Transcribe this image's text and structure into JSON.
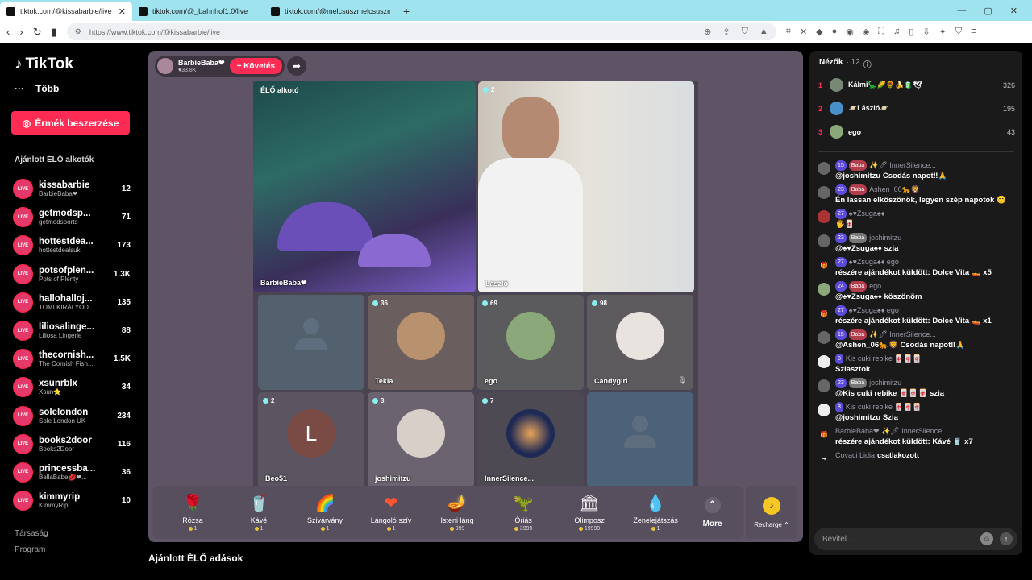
{
  "tabs": [
    {
      "title": "tiktok.com/@kissabarbie/live"
    },
    {
      "title": "tiktok.com/@_bahnhof1.0/live"
    },
    {
      "title": "tiktok.com/@melcsuszmelcsuszmelcs"
    }
  ],
  "address": {
    "url": "https://www.tiktok.com/@kissabarbie/live"
  },
  "sidebar": {
    "logo": "TikTok",
    "more": "Több",
    "coins_button": "Érmék beszerzése",
    "recommended_title": "Ajánlott ÉLŐ alkotók",
    "items": [
      {
        "name": "kissabarbie",
        "sub": "BarbieBaba❤",
        "count": "12"
      },
      {
        "name": "getmodsp...",
        "sub": "getmodsports",
        "count": "71"
      },
      {
        "name": "hottestdea...",
        "sub": "hottestdealsuk",
        "count": "173"
      },
      {
        "name": "potsofplen...",
        "sub": "Pots of Plenty",
        "count": "1.3K"
      },
      {
        "name": "hallohalloj...",
        "sub": "TOMI KIRÁLYOD...",
        "count": "135"
      },
      {
        "name": "liliosalinge...",
        "sub": "Liliosa Lingerie",
        "count": "88"
      },
      {
        "name": "thecornish...",
        "sub": "The Cornish Fish...",
        "count": "1.5K"
      },
      {
        "name": "xsunrblx",
        "sub": "Xsun⭐",
        "count": "34"
      },
      {
        "name": "solelondon",
        "sub": "Sole London UK",
        "count": "234"
      },
      {
        "name": "books2door",
        "sub": "Books2Door",
        "count": "116"
      },
      {
        "name": "princessba...",
        "sub": "BellaBabe💋❤...",
        "count": "36"
      },
      {
        "name": "kimmyrip",
        "sub": "KimmyRip",
        "count": "10"
      }
    ],
    "footer": [
      "Társaság",
      "Program"
    ]
  },
  "stage": {
    "host_name": "BarbieBaba❤",
    "host_likes": "33.8K",
    "follow": "+ Követés",
    "main_tile_top": "ÉLŐ alkotó",
    "main_tile_name": "BarbieBaba❤",
    "guest_count": "2",
    "guest_name": "László",
    "tiles": [
      {
        "name": "",
        "count": ""
      },
      {
        "name": "Tekla",
        "count": "36"
      },
      {
        "name": "ego",
        "count": "69"
      },
      {
        "name": "Candygirl",
        "count": "98"
      },
      {
        "name": "Beo51",
        "count": "2",
        "initial": "L"
      },
      {
        "name": "joshimitzu",
        "count": "3"
      },
      {
        "name": "InnerSilence...",
        "count": "7"
      },
      {
        "name": "",
        "count": ""
      }
    ],
    "gifts": [
      {
        "name": "Rózsa",
        "price": "1",
        "icon": "🌹"
      },
      {
        "name": "Kávé",
        "price": "1",
        "icon": "🥤"
      },
      {
        "name": "Szivárvány",
        "price": "1",
        "icon": "🌈"
      },
      {
        "name": "Lángoló szív",
        "price": "1",
        "icon": "❤"
      },
      {
        "name": "Isteni láng",
        "price": "999",
        "icon": "🪔"
      },
      {
        "name": "Óriás",
        "price": "3999",
        "icon": "🦖"
      },
      {
        "name": "Olimposz",
        "price": "19999",
        "icon": "🏛"
      },
      {
        "name": "Zenelejátszás",
        "price": "1",
        "icon": "💧"
      }
    ],
    "more": "More",
    "recharge": "Recharge"
  },
  "below_title": "Ajánlott ÉLŐ adások",
  "chat": {
    "viewers_label": "Nézők",
    "viewers_count": "· 12",
    "top": [
      {
        "rank": "1",
        "name": "Kálmi🦕🌽🌻🍌🧃🕊",
        "score": "326"
      },
      {
        "rank": "2",
        "name": "🪐László🪐",
        "score": "195"
      },
      {
        "rank": "3",
        "name": "ego",
        "score": "43"
      }
    ],
    "messages": [
      {
        "lv": "15",
        "fan": "Baba",
        "user": "✨🖊 InnerSilence...",
        "text": "@joshimitzu Csodás napot‼🙏"
      },
      {
        "lv": "23",
        "fan": "Baba",
        "user": "Ashen_06🐆🦁",
        "text": "Én lassan elköszönök, legyen szép napotok 😊"
      },
      {
        "lv": "27",
        "fan": "",
        "user": "♠♥Zsuga♠♦",
        "text": "🖐🀄"
      },
      {
        "lv": "23",
        "fan": "Baba",
        "user": "joshimitzu",
        "text": "@♠♥Zsuga♠♦ szia"
      },
      {
        "lv": "27",
        "fan": "",
        "user": "♠♥Zsuga♠♦ ego",
        "text": "részére ajándékot küldött: Dolce Vita 🚤 x5"
      },
      {
        "lv": "24",
        "fan": "Baba",
        "user": "ego",
        "text": "@♠♥Zsuga♠♦ köszönöm"
      },
      {
        "lv": "27",
        "fan": "",
        "user": "♠♥Zsuga♠♦ ego",
        "text": "részére ajándékot küldött: Dolce Vita 🚤 x1"
      },
      {
        "lv": "15",
        "fan": "Baba",
        "user": "✨🖊 InnerSilence...",
        "text": "@Ashen_06🐆🦁 Csodás napot‼🙏"
      },
      {
        "lv": "8",
        "fan": "",
        "user": "Kis cuki rebike 🀄🀄🀄",
        "text": "Sziasztok"
      },
      {
        "lv": "23",
        "fan": "Baba",
        "user": "joshimitzu",
        "text": "@Kis cuki rebike 🀄🀄🀄 szia"
      },
      {
        "lv": "8",
        "fan": "",
        "user": "Kis cuki rebike 🀄🀄🀄",
        "text": "@joshimitzu Szia"
      },
      {
        "lv": "",
        "fan": "",
        "user": "BarbieBaba❤ ✨🖊 InnerSilence...",
        "text": "részére ajándékot küldött: Kávé 🥤 x7"
      },
      {
        "lv": "",
        "fan": "",
        "user": "Covaci Lidia",
        "text": "csatlakozott"
      }
    ],
    "input_placeholder": "Bevitel..."
  }
}
